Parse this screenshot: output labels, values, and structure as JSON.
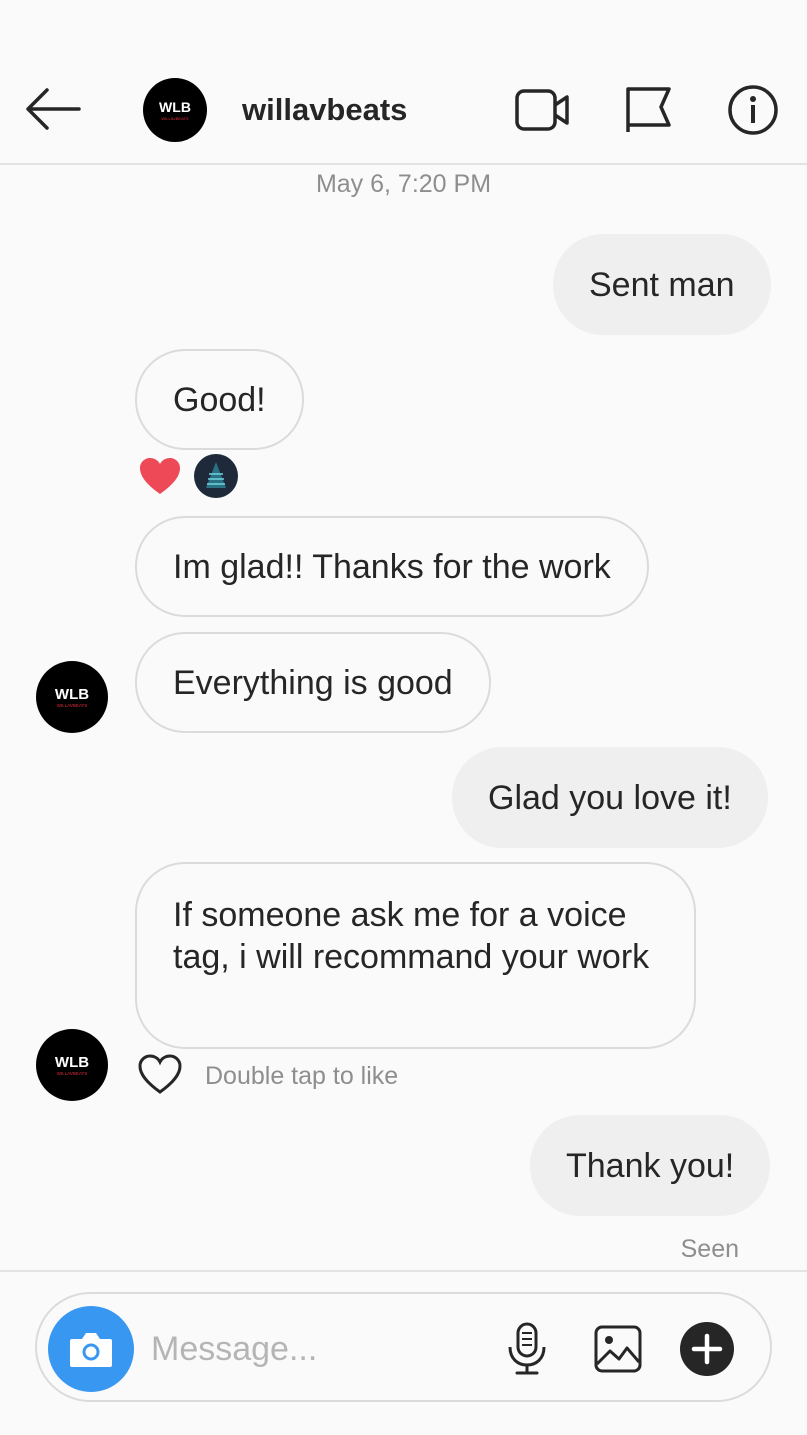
{
  "header": {
    "username": "willavbeats",
    "avatar_logo": "WLB",
    "avatar_logo_sub": "WILLAVBEATS",
    "icons": [
      "back-arrow-icon",
      "video-call-icon",
      "flag-icon",
      "info-icon"
    ]
  },
  "thread": {
    "timestamp": "May 6, 7:20 PM",
    "messages": [
      {
        "from": "me",
        "text": "Sent man"
      },
      {
        "from": "them",
        "text": "Good!"
      },
      {
        "from": "them",
        "text": "Im glad!! Thanks for the work"
      },
      {
        "from": "them",
        "text": "Everything is good"
      },
      {
        "from": "me",
        "text": "Glad you love it!"
      },
      {
        "from": "them",
        "text": "If someone ask me for a voice tag, i will recommand your work"
      },
      {
        "from": "me",
        "text": "Thank you!"
      }
    ],
    "reactions": [
      "heart-icon",
      "reactor-avatar"
    ],
    "like_hint": "Double tap to like",
    "seen": "Seen"
  },
  "composer": {
    "placeholder": "Message...",
    "icons": [
      "camera-icon",
      "microphone-icon",
      "gallery-icon",
      "plus-icon"
    ]
  },
  "colors": {
    "accent_blue": "#3897f0",
    "heart_red": "#ed4956",
    "bubble_gray": "#efefef",
    "border_gray": "#dbdbdb",
    "meta_text": "#8e8e8e"
  }
}
